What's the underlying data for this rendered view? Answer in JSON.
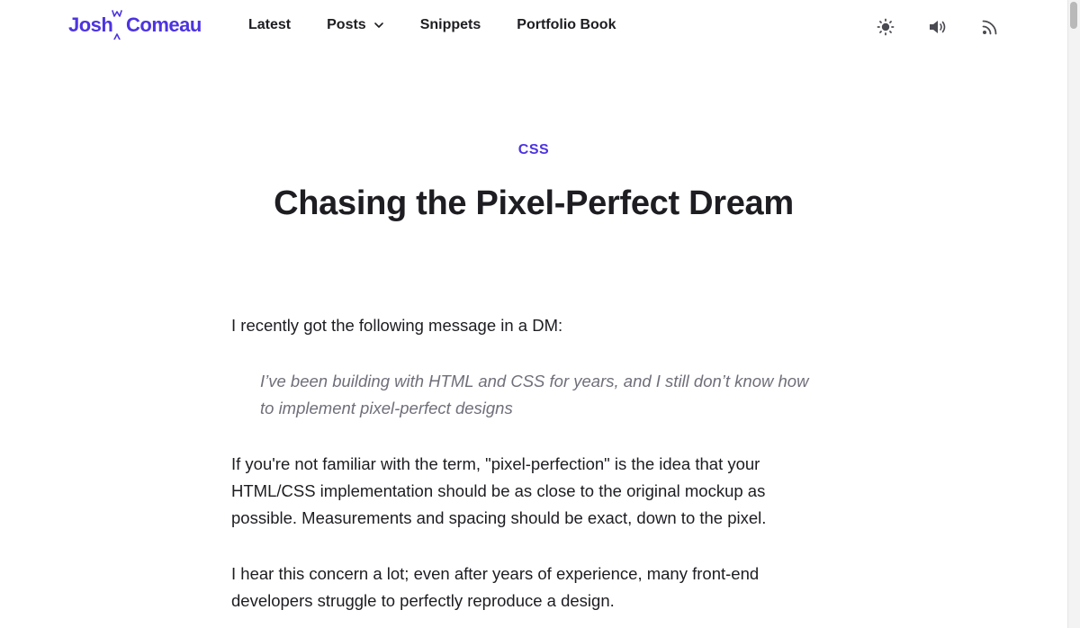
{
  "header": {
    "logo": {
      "first": "Josh",
      "last": "Comeau"
    },
    "nav": [
      {
        "label": "Latest",
        "has_dropdown": false
      },
      {
        "label": "Posts",
        "has_dropdown": true
      },
      {
        "label": "Snippets",
        "has_dropdown": false
      },
      {
        "label": "Portfolio Book",
        "has_dropdown": false
      }
    ],
    "tools": [
      "sun-icon",
      "speaker-icon",
      "rss-icon"
    ]
  },
  "article": {
    "category": "CSS",
    "title": "Chasing the Pixel-Perfect Dream",
    "intro": "I recently got the following message in a DM:",
    "quote": "I’ve been building with HTML and CSS for years, and I still don’t know how to implement pixel-perfect designs",
    "paragraph1": "If you're not familiar with the term, \"pixel-perfection\" is the idea that your HTML/CSS implementation should be as close to the original mockup as possible. Measurements and spacing should be exact, down to the pixel.",
    "paragraph2": "I hear this concern a lot; even after years of experience, many front-end developers struggle to perfectly reproduce a design."
  },
  "colors": {
    "accent": "#4c34e0",
    "text": "#1d1d22",
    "quote": "#6f6f7a"
  }
}
